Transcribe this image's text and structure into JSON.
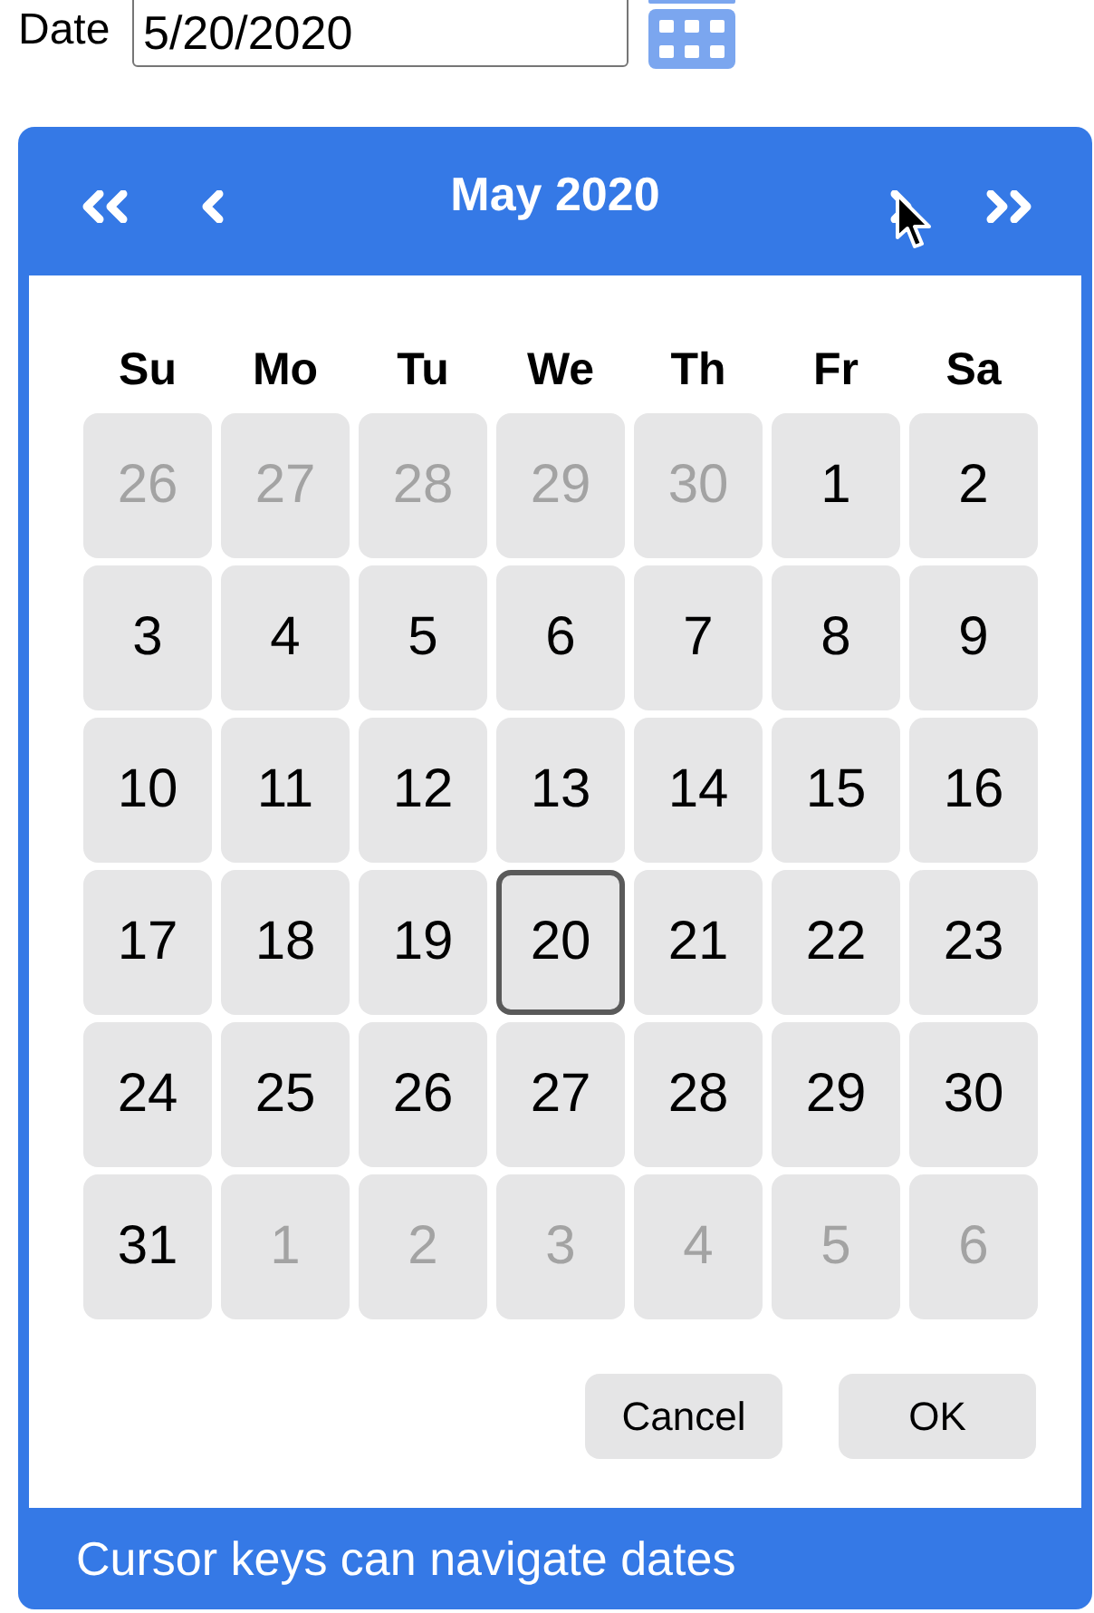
{
  "date_field": {
    "label": "Date",
    "value": "5/20/2020"
  },
  "calendar": {
    "title": "May 2020",
    "weekdays": [
      "Su",
      "Mo",
      "Tu",
      "We",
      "Th",
      "Fr",
      "Sa"
    ],
    "weeks": [
      {
        "days": [
          {
            "day": "26",
            "other_month": true,
            "selected": false
          },
          {
            "day": "27",
            "other_month": true,
            "selected": false
          },
          {
            "day": "28",
            "other_month": true,
            "selected": false
          },
          {
            "day": "29",
            "other_month": true,
            "selected": false
          },
          {
            "day": "30",
            "other_month": true,
            "selected": false
          },
          {
            "day": "1",
            "other_month": false,
            "selected": false
          },
          {
            "day": "2",
            "other_month": false,
            "selected": false
          }
        ]
      },
      {
        "days": [
          {
            "day": "3",
            "other_month": false,
            "selected": false
          },
          {
            "day": "4",
            "other_month": false,
            "selected": false
          },
          {
            "day": "5",
            "other_month": false,
            "selected": false
          },
          {
            "day": "6",
            "other_month": false,
            "selected": false
          },
          {
            "day": "7",
            "other_month": false,
            "selected": false
          },
          {
            "day": "8",
            "other_month": false,
            "selected": false
          },
          {
            "day": "9",
            "other_month": false,
            "selected": false
          }
        ]
      },
      {
        "days": [
          {
            "day": "10",
            "other_month": false,
            "selected": false
          },
          {
            "day": "11",
            "other_month": false,
            "selected": false
          },
          {
            "day": "12",
            "other_month": false,
            "selected": false
          },
          {
            "day": "13",
            "other_month": false,
            "selected": false
          },
          {
            "day": "14",
            "other_month": false,
            "selected": false
          },
          {
            "day": "15",
            "other_month": false,
            "selected": false
          },
          {
            "day": "16",
            "other_month": false,
            "selected": false
          }
        ]
      },
      {
        "days": [
          {
            "day": "17",
            "other_month": false,
            "selected": false
          },
          {
            "day": "18",
            "other_month": false,
            "selected": false
          },
          {
            "day": "19",
            "other_month": false,
            "selected": false
          },
          {
            "day": "20",
            "other_month": false,
            "selected": true
          },
          {
            "day": "21",
            "other_month": false,
            "selected": false
          },
          {
            "day": "22",
            "other_month": false,
            "selected": false
          },
          {
            "day": "23",
            "other_month": false,
            "selected": false
          }
        ]
      },
      {
        "days": [
          {
            "day": "24",
            "other_month": false,
            "selected": false
          },
          {
            "day": "25",
            "other_month": false,
            "selected": false
          },
          {
            "day": "26",
            "other_month": false,
            "selected": false
          },
          {
            "day": "27",
            "other_month": false,
            "selected": false
          },
          {
            "day": "28",
            "other_month": false,
            "selected": false
          },
          {
            "day": "29",
            "other_month": false,
            "selected": false
          },
          {
            "day": "30",
            "other_month": false,
            "selected": false
          }
        ]
      },
      {
        "days": [
          {
            "day": "31",
            "other_month": false,
            "selected": false
          },
          {
            "day": "1",
            "other_month": true,
            "selected": false
          },
          {
            "day": "2",
            "other_month": true,
            "selected": false
          },
          {
            "day": "3",
            "other_month": true,
            "selected": false
          },
          {
            "day": "4",
            "other_month": true,
            "selected": false
          },
          {
            "day": "5",
            "other_month": true,
            "selected": false
          },
          {
            "day": "6",
            "other_month": true,
            "selected": false
          }
        ]
      }
    ],
    "buttons": [
      {
        "label": "Cancel"
      },
      {
        "label": "OK"
      }
    ],
    "hint": "Cursor keys can navigate dates"
  }
}
